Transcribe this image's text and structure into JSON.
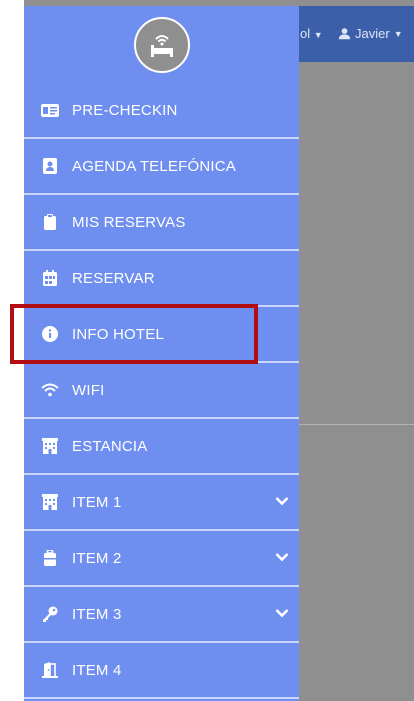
{
  "topbar": {
    "language_label": "ol",
    "user_label": "Javier"
  },
  "menu": [
    {
      "label": "PRE-CHECKIN",
      "icon": "id-card-icon"
    },
    {
      "label": "AGENDA TELEFÓNICA",
      "icon": "address-book-icon"
    },
    {
      "label": "MIS RESERVAS",
      "icon": "clipboard-icon"
    },
    {
      "label": "RESERVAR",
      "icon": "calendar-icon"
    },
    {
      "label": "INFO HOTEL",
      "icon": "info-icon"
    },
    {
      "label": "WIFI",
      "icon": "wifi-icon"
    },
    {
      "label": "ESTANCIA",
      "icon": "hotel-building-icon"
    },
    {
      "label": "ITEM 1",
      "icon": "hotel-building-icon",
      "expandable": true
    },
    {
      "label": "ITEM 2",
      "icon": "suitcase-icon",
      "expandable": true
    },
    {
      "label": "ITEM 3",
      "icon": "key-icon",
      "expandable": true
    },
    {
      "label": "ITEM 4",
      "icon": "door-icon"
    }
  ],
  "colors": {
    "sidebar": "#6f8ff0",
    "topbar": "#3b5fa8",
    "highlight": "#b20d12"
  }
}
